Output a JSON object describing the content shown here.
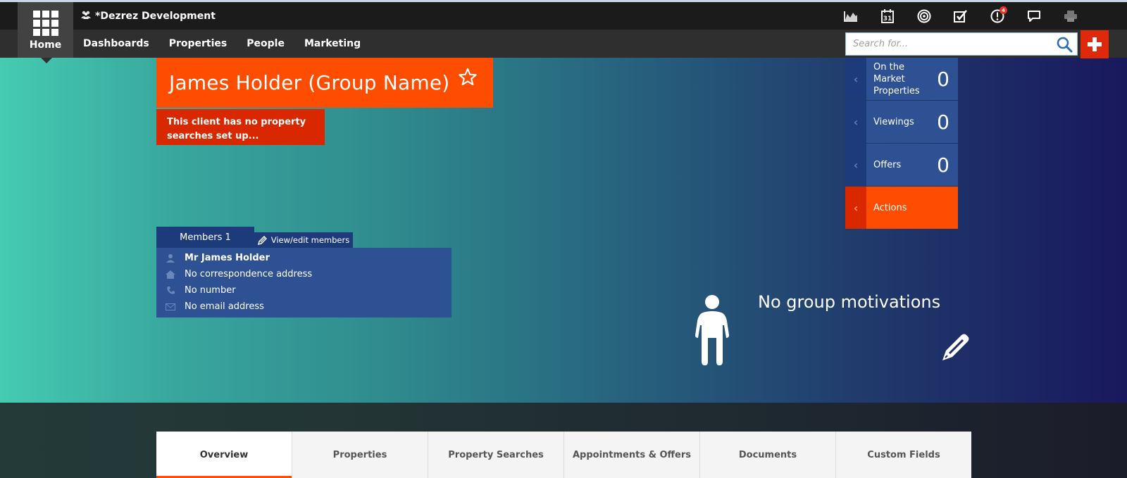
{
  "app": {
    "brand": "*Dezrez Development",
    "home_label": "Home"
  },
  "nav": {
    "items": [
      "Dashboards",
      "Properties",
      "People",
      "Marketing"
    ]
  },
  "toolbar": {
    "icons": [
      "chart-icon",
      "calendar-icon",
      "target-icon",
      "checkbox-icon",
      "alert-icon",
      "chat-icon",
      "printer-icon"
    ],
    "alert_badge": "4"
  },
  "search": {
    "placeholder": "Search for...",
    "value": ""
  },
  "header": {
    "title": "James Holder (Group Name)",
    "alert": "This client has no property searches set up..."
  },
  "members": {
    "tab_label": "Members 1",
    "edit_label": "View/edit members",
    "name": "Mr James Holder",
    "address": "No correspondence address",
    "phone": "No number",
    "email": "No email address"
  },
  "side_panel": {
    "items": [
      {
        "label": "On the Market Properties",
        "count": "0"
      },
      {
        "label": "Viewings",
        "count": "0"
      },
      {
        "label": "Offers",
        "count": "0"
      },
      {
        "label": "Actions",
        "count": ""
      }
    ]
  },
  "motivations": {
    "text": "No group motivations"
  },
  "tabs": [
    {
      "label": "Overview",
      "active": true
    },
    {
      "label": "Properties",
      "active": false
    },
    {
      "label": "Property Searches",
      "active": false
    },
    {
      "label": "Appointments & Offers",
      "active": false
    },
    {
      "label": "Documents",
      "active": false
    },
    {
      "label": "Custom Fields",
      "active": false
    }
  ],
  "colors": {
    "accent_orange": "#fe4c00",
    "alert_red": "#d92700",
    "panel_blue": "#2e5193",
    "panel_dark_blue": "#1d3b7a"
  }
}
